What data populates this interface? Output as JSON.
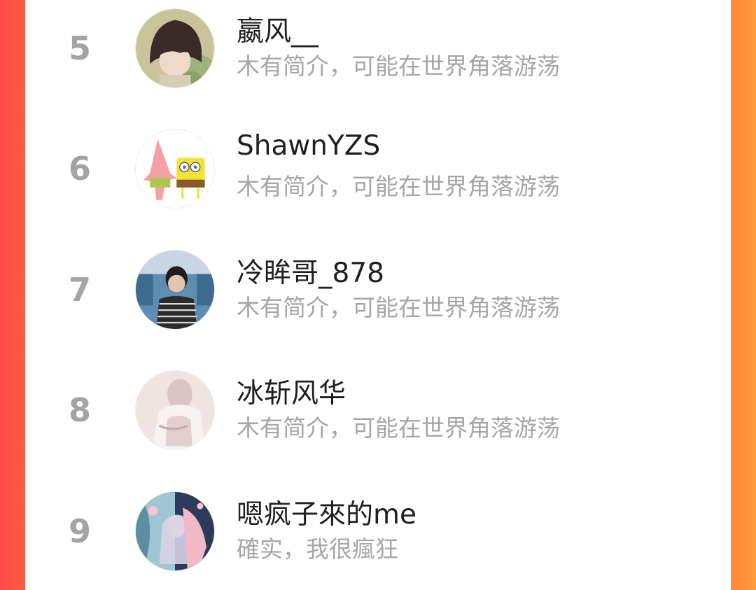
{
  "colors": {
    "background_left": "#ff4a48",
    "background_right": "#ff9a3c",
    "panel": "#ffffff",
    "rank_text": "#a3a3a3",
    "name_text": "#1f1f1f",
    "bio_text": "#a6a6a6"
  },
  "ranking": {
    "items": [
      {
        "rank": "5",
        "name": "嬴风__",
        "bio": "木有简介，可能在世界角落游荡",
        "avatar_icon": "boy-illustration-avatar"
      },
      {
        "rank": "6",
        "name": "ShawnYZS",
        "bio": "木有简介，可能在世界角落游荡",
        "avatar_icon": "patrick-spongebob-avatar"
      },
      {
        "rank": "7",
        "name": "冷眸哥_878",
        "bio": "木有简介，可能在世界角落游荡",
        "avatar_icon": "boy-photo-avatar"
      },
      {
        "rank": "8",
        "name": "冰斩风华",
        "bio": "木有简介，可能在世界角落游荡",
        "avatar_icon": "girl-photo-avatar"
      },
      {
        "rank": "9",
        "name": "嗯疯子來的me",
        "bio": "確实，我很瘋狂",
        "avatar_icon": "anime-art-avatar"
      }
    ]
  }
}
